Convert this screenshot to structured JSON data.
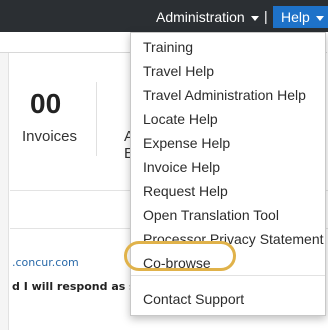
{
  "nav": {
    "administration": "Administration",
    "separator": "|",
    "help": "Help"
  },
  "dashboard": {
    "invoices_count": "00",
    "invoices_label": "Invoices",
    "clipped_label_1": "A",
    "clipped_label_2": "E"
  },
  "content": {
    "email_fragment": ".concur.com",
    "reply_fragment": "d I will respond as s"
  },
  "help_menu": {
    "items": [
      "Training",
      "Travel Help",
      "Travel Administration Help",
      "Locate Help",
      "Expense Help",
      "Invoice Help",
      "Request Help",
      "Open Translation Tool",
      "Processor Privacy Statement",
      "Co-browse"
    ],
    "footer_item": "Contact Support",
    "highlighted_item": "Co-browse"
  },
  "colors": {
    "topbar": "#2b2f33",
    "help_active": "#1e72c9",
    "highlight": "#e0b24a"
  }
}
